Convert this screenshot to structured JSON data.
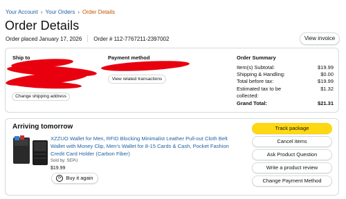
{
  "breadcrumb": [
    {
      "label": "Your Account"
    },
    {
      "label": "Your Orders"
    },
    {
      "label": "Order Details"
    }
  ],
  "breadcrumb_separator": "›",
  "page_title": "Order Details",
  "order_meta": {
    "placed": "Order placed January 17, 2026",
    "number": "Order # 112-7767211-2397002"
  },
  "view_invoice_label": "View invoice",
  "shipping": {
    "label": "Ship to",
    "change_address_label": "Change shipping address"
  },
  "payment": {
    "label": "Payment method",
    "view_related_label": "View related transactions"
  },
  "summary": {
    "title": "Order Summary",
    "rows": [
      {
        "label": "Item(s) Subtotal:",
        "value": "$19.99"
      },
      {
        "label": "Shipping & Handling:",
        "value": "$0.00"
      },
      {
        "label": "Total before tax:",
        "value": "$19.99"
      },
      {
        "label": "Estimated tax to be",
        "value": "$1.32"
      },
      {
        "label": "collected:",
        "value": ""
      }
    ],
    "grand_total_label": "Grand Total:",
    "grand_total_value": "$21.31"
  },
  "shipment": {
    "status": "Arriving tomorrow",
    "product_title": "XZZUO Wallet for Men, RFID Blocking Minimalist Leather Pull-out Cloth Belt Wallet with Money Clip, Men's Wallet for 8-15 Cards & Cash, Pocket Fashion Credit Card Holder (Carbon Fiber)",
    "sold_by": "Sold by: SEPU",
    "price": "$19.99",
    "buy_again_label": "Buy it again",
    "buy_again_icon": "reorder-icon"
  },
  "actions": [
    {
      "label": "Track package"
    },
    {
      "label": "Cancel items"
    },
    {
      "label": "Ask Product Question"
    },
    {
      "label": "Write a product review"
    },
    {
      "label": "Change Payment Method"
    }
  ],
  "colors": {
    "link": "#2162a1",
    "breadcrumb_current": "#c45500",
    "primary_button": "#ffd814",
    "redaction": "#e8000f"
  }
}
